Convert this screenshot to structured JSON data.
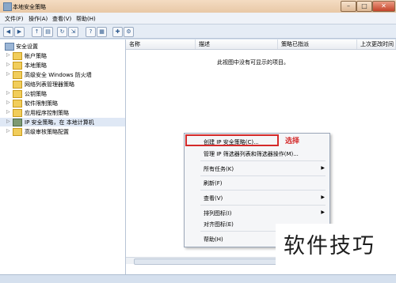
{
  "window": {
    "title": "本地安全策略"
  },
  "menubar": [
    "文件(F)",
    "操作(A)",
    "查看(V)",
    "帮助(H)"
  ],
  "tree": [
    {
      "label": "安全设置",
      "depth": 0,
      "expander": ""
    },
    {
      "label": "帐户策略",
      "depth": 1,
      "expander": "▷"
    },
    {
      "label": "本地策略",
      "depth": 1,
      "expander": "▷"
    },
    {
      "label": "高级安全 Windows 防火墙",
      "depth": 1,
      "expander": "▷"
    },
    {
      "label": "网络列表管理器策略",
      "depth": 1,
      "expander": ""
    },
    {
      "label": "公钥策略",
      "depth": 1,
      "expander": "▷"
    },
    {
      "label": "软件限制策略",
      "depth": 1,
      "expander": "▷"
    },
    {
      "label": "应用程序控制策略",
      "depth": 1,
      "expander": "▷"
    },
    {
      "label": "IP 安全策略，在 本地计算机",
      "depth": 1,
      "expander": "▷"
    },
    {
      "label": "高级审核策略配置",
      "depth": 1,
      "expander": "▷"
    }
  ],
  "columns": [
    "名称",
    "描述",
    "策略已指派",
    "上次更改时间"
  ],
  "empty_message": "此视图中没有可显示的项目。",
  "context_menu": [
    {
      "label": "创建 IP 安全策略(C)...",
      "arrow": ""
    },
    {
      "label": "管理 IP 筛选器列表和筛选器操作(M)...",
      "arrow": ""
    },
    {
      "label": "所有任务(K)",
      "arrow": "▶"
    },
    {
      "label": "刷新(F)",
      "arrow": ""
    },
    {
      "label": "查看(V)",
      "arrow": "▶"
    },
    {
      "label": "排列图标(I)",
      "arrow": "▶"
    },
    {
      "label": "对齐图标(E)",
      "arrow": ""
    },
    {
      "label": "帮助(H)",
      "arrow": ""
    }
  ],
  "annotation": "选择",
  "watermark": "软件技巧",
  "colors": {
    "highlight": "#d42a2a"
  }
}
